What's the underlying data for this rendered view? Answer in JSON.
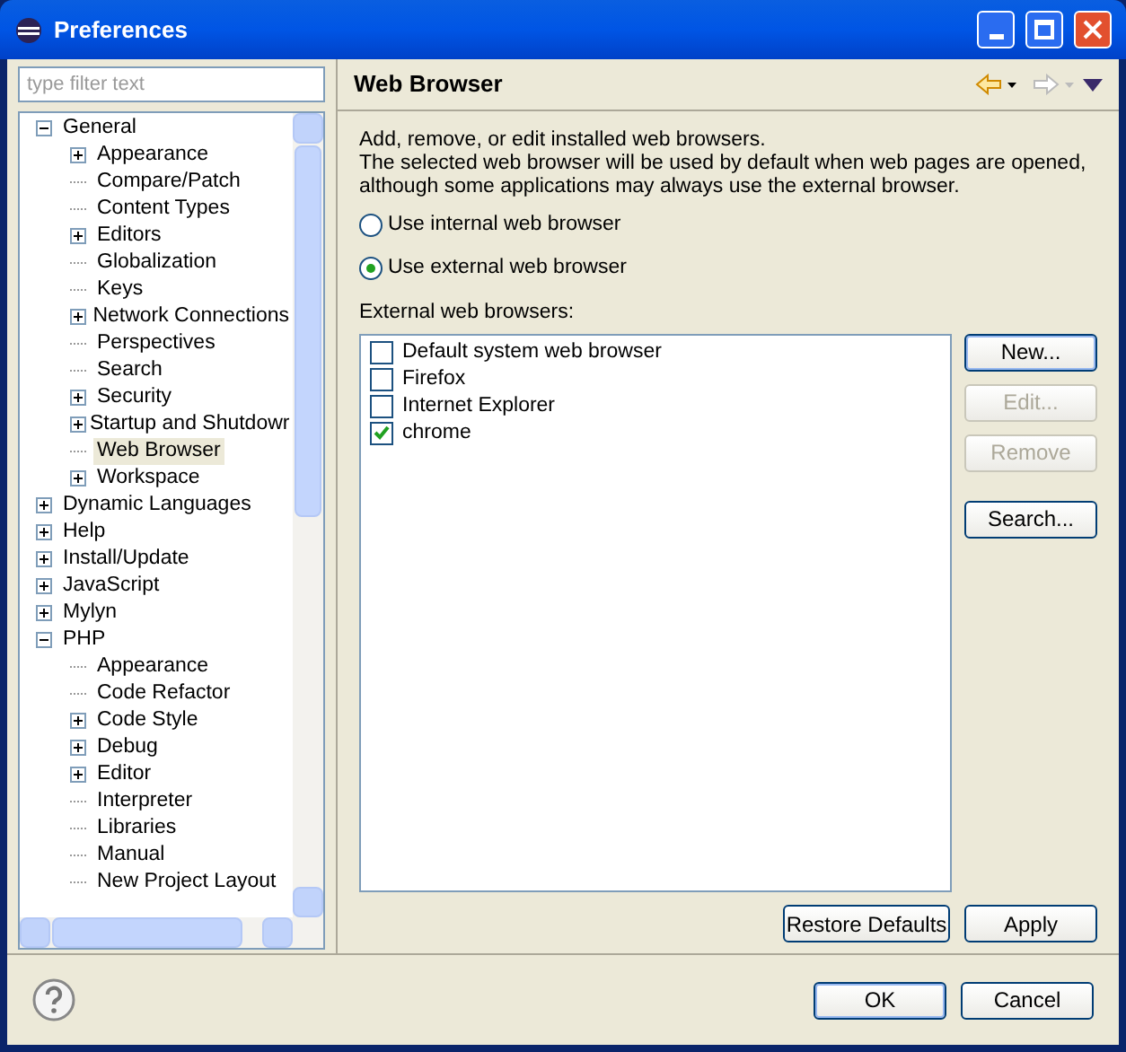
{
  "window": {
    "title": "Preferences"
  },
  "filter": {
    "placeholder": "type filter text"
  },
  "tree": [
    {
      "label": "General",
      "expanded": true,
      "selected": false,
      "children": [
        {
          "label": "Appearance",
          "expanded": false,
          "selected": false
        },
        {
          "label": "Compare/Patch",
          "selected": false
        },
        {
          "label": "Content Types",
          "selected": false
        },
        {
          "label": "Editors",
          "expanded": false,
          "selected": false
        },
        {
          "label": "Globalization",
          "selected": false
        },
        {
          "label": "Keys",
          "selected": false
        },
        {
          "label": "Network Connections",
          "expanded": false,
          "selected": false
        },
        {
          "label": "Perspectives",
          "selected": false
        },
        {
          "label": "Search",
          "selected": false
        },
        {
          "label": "Security",
          "expanded": false,
          "selected": false
        },
        {
          "label": "Startup and Shutdowr",
          "expanded": false,
          "selected": false
        },
        {
          "label": "Web Browser",
          "selected": true
        },
        {
          "label": "Workspace",
          "expanded": false,
          "selected": false
        }
      ]
    },
    {
      "label": "Dynamic Languages",
      "expanded": false,
      "selected": false
    },
    {
      "label": "Help",
      "expanded": false,
      "selected": false
    },
    {
      "label": "Install/Update",
      "expanded": false,
      "selected": false
    },
    {
      "label": "JavaScript",
      "expanded": false,
      "selected": false
    },
    {
      "label": "Mylyn",
      "expanded": false,
      "selected": false
    },
    {
      "label": "PHP",
      "expanded": true,
      "selected": false,
      "children": [
        {
          "label": "Appearance",
          "selected": false
        },
        {
          "label": "Code Refactor",
          "selected": false
        },
        {
          "label": "Code Style",
          "expanded": false,
          "selected": false
        },
        {
          "label": "Debug",
          "expanded": false,
          "selected": false
        },
        {
          "label": "Editor",
          "expanded": false,
          "selected": false
        },
        {
          "label": "Interpreter",
          "selected": false
        },
        {
          "label": "Libraries",
          "selected": false
        },
        {
          "label": "Manual",
          "selected": false
        },
        {
          "label": "New Project Layout",
          "selected": false
        }
      ]
    }
  ],
  "page": {
    "title": "Web Browser",
    "description": [
      "Add, remove, or edit installed web browsers.",
      "The selected web browser will be used by default when web pages are opened,",
      "although some applications may always use the external browser."
    ],
    "options": [
      {
        "label": "Use internal web browser",
        "selected": false
      },
      {
        "label": "Use external web browser",
        "selected": true
      }
    ],
    "list_label": "External web browsers:",
    "browsers": [
      {
        "name": "Default system web browser",
        "checked": false
      },
      {
        "name": "Firefox",
        "checked": false
      },
      {
        "name": "Internet Explorer",
        "checked": false
      },
      {
        "name": "chrome",
        "checked": true
      }
    ],
    "side_buttons": [
      {
        "label": "New...",
        "disabled": false,
        "focused": true
      },
      {
        "label": "Edit...",
        "disabled": true,
        "focused": false
      },
      {
        "label": "Remove",
        "disabled": true,
        "focused": false
      },
      {
        "label": "Search...",
        "disabled": false,
        "focused": false
      }
    ],
    "buttons": [
      "Restore Defaults",
      "Apply"
    ]
  },
  "dialog_buttons": [
    "OK",
    "Cancel"
  ]
}
